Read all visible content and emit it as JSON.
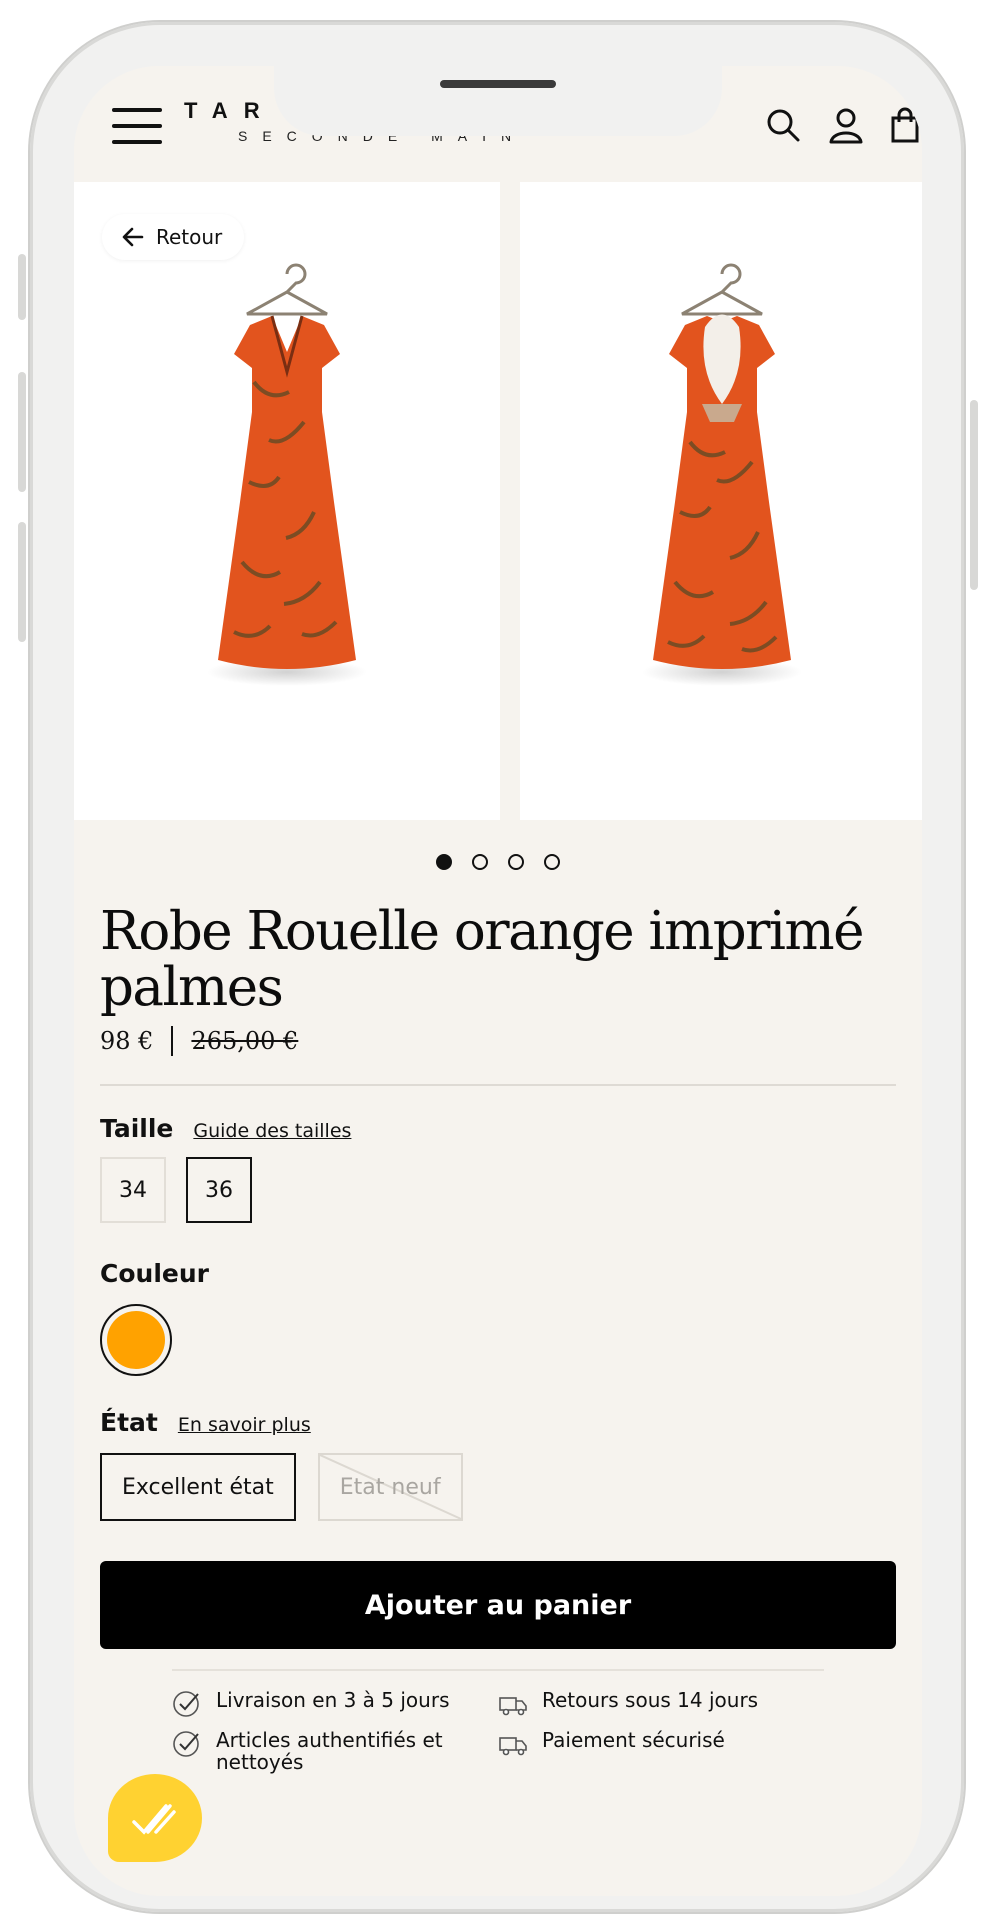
{
  "header": {
    "brand": "TAR",
    "brand_sub": "SECONDE MAIN",
    "icons": [
      "menu-icon",
      "search-icon",
      "account-icon",
      "bag-icon"
    ]
  },
  "gallery": {
    "back_label": "Retour",
    "slide_count": 4,
    "active_slide": 1
  },
  "product": {
    "title": "Robe Rouelle orange imprimé palmes",
    "price": "98 €",
    "original_price": "265,00 €"
  },
  "size": {
    "label": "Taille",
    "guide_link": "Guide des tailles",
    "options": [
      "34",
      "36"
    ],
    "selected": "36"
  },
  "color": {
    "label": "Couleur",
    "swatch": "#ffa200"
  },
  "condition": {
    "label": "État",
    "more_link": "En savoir plus",
    "options": [
      "Excellent état",
      "Etat neuf"
    ],
    "selected": "Excellent état"
  },
  "cart": {
    "button": "Ajouter au panier"
  },
  "reassurance": {
    "delivery": "Livraison en 3 à 5 jours",
    "returns": "Retours sous 14 jours",
    "authentic": "Articles authentifiés et nettoyés",
    "payment": "Paiement sécurisé"
  },
  "colors": {
    "background": "#f6f3ee",
    "dress": "#e2541e",
    "chat": "#ffd231"
  }
}
